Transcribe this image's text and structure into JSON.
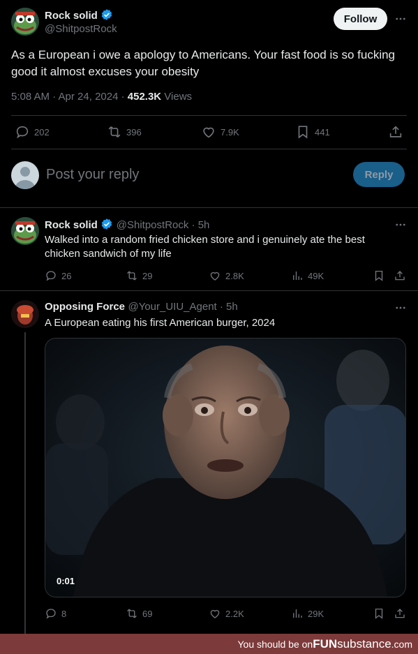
{
  "main_tweet": {
    "author_name": "Rock solid",
    "author_handle": "@ShitpostRock",
    "follow_label": "Follow",
    "text": "As a European i owe a apology to Americans. Your fast food is so fucking good it almost excuses your obesity",
    "timestamp": "5:08 AM · Apr 24, 2024 · ",
    "views_count": "452.3K",
    "views_label": " Views",
    "replies": "202",
    "retweets": "396",
    "likes": "7.9K",
    "bookmarks": "441"
  },
  "reply_box": {
    "placeholder": "Post your reply",
    "button_label": "Reply"
  },
  "reply1": {
    "author_name": "Rock solid",
    "author_handle": "@ShitpostRock · 5h",
    "text_line1": "Walked into a random fried chicken store and i genuinely ate the best",
    "text_line2": "chicken sandwich of my life",
    "replies": "26",
    "retweets": "29",
    "likes": "2.8K",
    "views": "49K"
  },
  "reply2": {
    "author_name": "Opposing Force",
    "author_handle": "@Your_UIU_Agent · 5h",
    "text": "A European eating his first American burger, 2024",
    "video_time": "0:01",
    "replies": "8",
    "retweets": "69",
    "likes": "2.2K",
    "views": "29K"
  },
  "footer": {
    "text": "You should be on ",
    "brand_bold": "FUN",
    "brand_rest": "substance",
    "brand_tld": ".com"
  },
  "colors": {
    "background": "#000000",
    "accent": "#1d9bf0",
    "muted": "#71767b",
    "divider": "#2f3336",
    "footer": "#7d3a3a"
  }
}
